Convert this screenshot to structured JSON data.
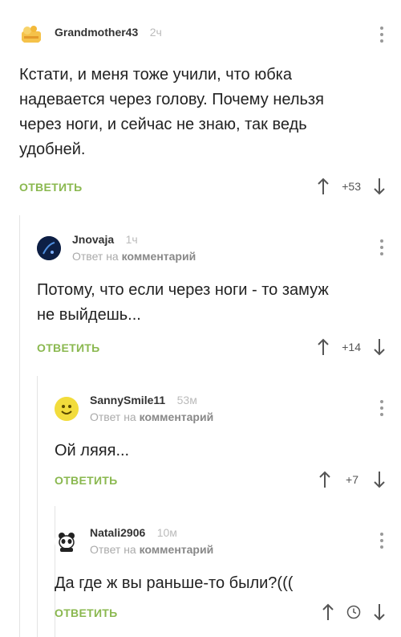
{
  "comments": [
    {
      "username": "Grandmother43",
      "time": "2ч",
      "text_lines": [
        "Кстати, и меня тоже учили, что юбка",
        "надевается через голову. Почему нельзя",
        "через ноги, и сейчас не знаю, так ведь",
        "удобней."
      ],
      "reply_label": "ОТВЕТИТЬ",
      "rating": "+53"
    },
    {
      "username": "Jnovaja",
      "time": "1ч",
      "reply_prefix": "Ответ на",
      "reply_target": "комментарий",
      "text_lines": [
        "Потому, что если через ноги - то замуж",
        "не выйдешь..."
      ],
      "reply_label": "ОТВЕТИТЬ",
      "rating": "+14"
    },
    {
      "username": "SannySmile11",
      "time": "53м",
      "reply_prefix": "Ответ на",
      "reply_target": "комментарий",
      "text_lines": [
        "Ой ляяя..."
      ],
      "reply_label": "ОТВЕТИТЬ",
      "rating": "+7"
    },
    {
      "username": "Natali2906",
      "time": "10м",
      "reply_prefix": "Ответ на",
      "reply_target": "комментарий",
      "text_lines": [
        "Да где ж вы раньше-то были?((("
      ],
      "reply_label": "ОТВЕТИТЬ",
      "rating_icon": "clock-icon"
    }
  ],
  "colors": {
    "reply_button": "#8ab84f",
    "thread_line": "#e3e3e3",
    "muted": "#aaaaaa"
  }
}
